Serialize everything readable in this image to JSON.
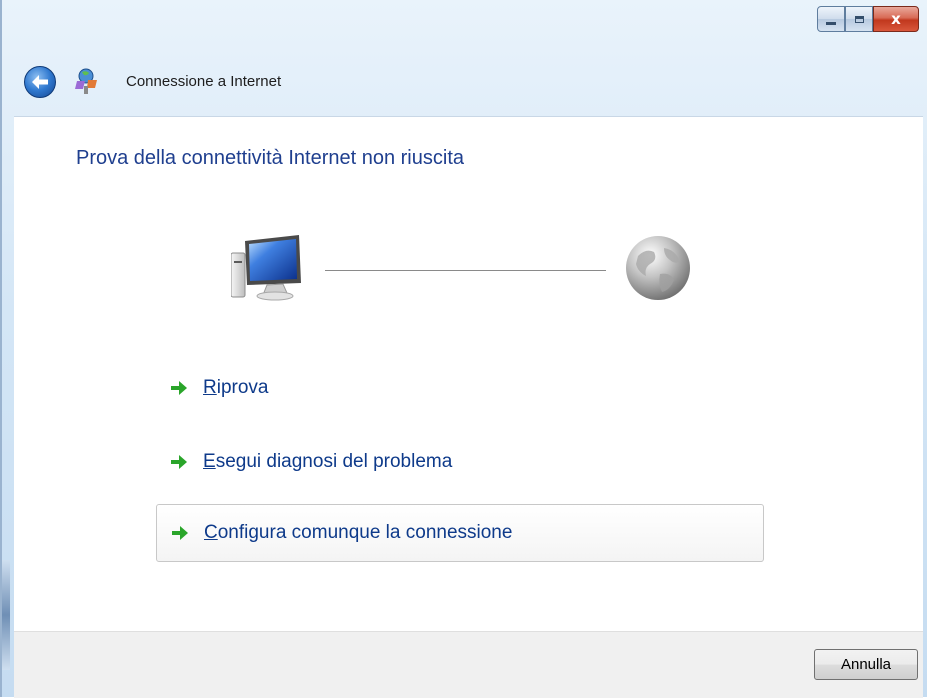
{
  "window": {
    "caption_buttons": {
      "close_glyph": "x"
    }
  },
  "nav": {
    "title": "Connessione a Internet",
    "back_icon": "back-arrow-icon",
    "app_icon": "network-wizard-icon"
  },
  "main": {
    "heading": "Prova della connettività Internet non riuscita",
    "diagram": {
      "left_icon": "computer-icon",
      "right_icon": "globe-icon"
    },
    "options": [
      {
        "first": "R",
        "rest": "iprova"
      },
      {
        "first": "E",
        "rest": "segui diagnosi del problema"
      },
      {
        "first": "C",
        "rest": "onfigura comunque la connessione"
      }
    ],
    "selected_option_index": 2
  },
  "footer": {
    "cancel_label": "Annulla"
  },
  "colors": {
    "heading": "#1f3f8f",
    "link": "#0e3a8a",
    "arrow": "#2aa52a"
  }
}
